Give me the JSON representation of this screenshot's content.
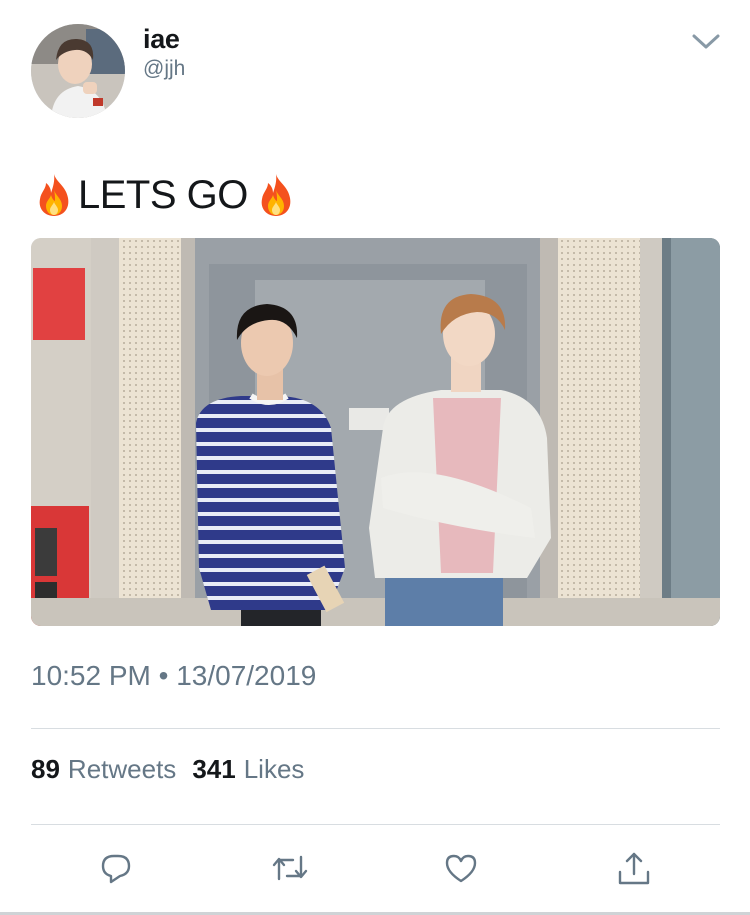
{
  "user": {
    "display_name": "iae",
    "handle": "@jjh"
  },
  "tweet": {
    "text": "LETS GO",
    "emoji_icon": "fire-icon",
    "timestamp": "10:52 PM • 13/07/2019"
  },
  "stats": {
    "retweets_count": "89",
    "retweets_label": "Retweets",
    "likes_count": "341",
    "likes_label": "Likes"
  },
  "actions": [
    {
      "icon": "reply-icon"
    },
    {
      "icon": "retweet-icon"
    },
    {
      "icon": "heart-icon"
    },
    {
      "icon": "share-icon"
    }
  ],
  "colors": {
    "text_primary": "#14171a",
    "text_secondary": "#657786",
    "divider": "#d8dde1"
  }
}
